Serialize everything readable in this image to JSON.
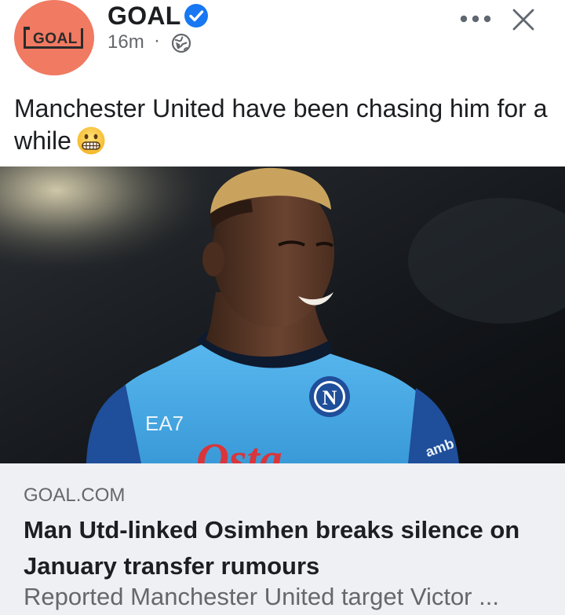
{
  "post": {
    "author": "GOAL",
    "avatar_logo_text": "GOAL",
    "time": "16m",
    "separator": "·",
    "caption": "Manchester United have been chasing him for a while"
  },
  "icons": {
    "verified": "verified-badge-icon",
    "audience": "globe-icon",
    "more": "more-options-icon",
    "close": "close-icon",
    "emoji": "grimacing-face-emoji"
  },
  "colors": {
    "avatar_bg": "#f07a62",
    "verified_blue": "#1877f2",
    "card_bg": "#eef0f3",
    "jersey_blue": "#3fa7e6"
  },
  "link_preview": {
    "domain": "GOAL.COM",
    "headline": "Man Utd-linked Osimhen breaks silence on January transfer rumours",
    "description": "Reported Manchester United target Victor ..."
  },
  "photo": {
    "jersey_brand": "EA7",
    "crest_letter": "N",
    "sponsor_partial": "Osta",
    "sleeve_partial": "amb"
  }
}
